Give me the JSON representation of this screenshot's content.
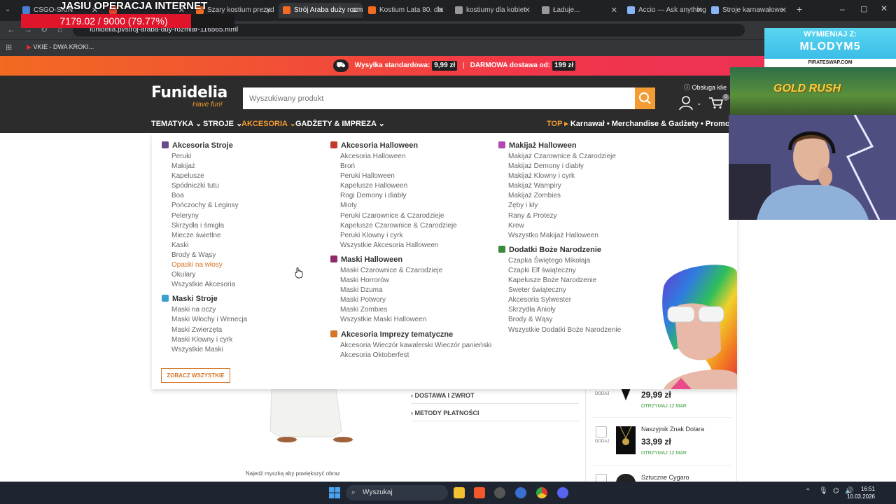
{
  "browser": {
    "tabs": [
      {
        "label": "CSGO-SKIN",
        "favicon_color": "#4a7fd6"
      },
      {
        "label": "",
        "favicon_color": "#e0452f"
      },
      {
        "label": "Szary kostium prezyd",
        "favicon_color": "#f36b21"
      },
      {
        "label": "Strój Araba duży rozm",
        "favicon_color": "#f36b21"
      },
      {
        "label": "Kostium Lata 80. dla",
        "favicon_color": "#f36b21"
      },
      {
        "label": "kostiumy dla kobiet",
        "favicon_color": "#999999"
      },
      {
        "label": "Ładuje...",
        "favicon_color": "#999999"
      },
      {
        "label": "Accio — Ask anything",
        "favicon_color": "#8ab4f8"
      },
      {
        "label": "Stroje karnawałowe",
        "favicon_color": "#8ab4f8"
      }
    ],
    "active_tab_index": 3,
    "url": "funidelia.pl/stroj-araba-duy-rozmiar-116565.html",
    "bookmark": "VKIE - DWA KROKI..."
  },
  "overlay": {
    "title": "JASIU OPERACJA INTERNET",
    "progress_text": "7179.02 / 9000 (79.77%)",
    "progress_fraction": 0.7977
  },
  "promo": {
    "standard_label": "Wysyłka standardowa:",
    "standard_price": "9,99 zł",
    "free_label": "DARMOWA dostawa od:",
    "free_price": "199 zł"
  },
  "header": {
    "logo": "Funidelia",
    "logo_tagline": "Have fun!",
    "search_placeholder": "Wyszukiwany produkt",
    "support_label": "Obsługa klie",
    "cart_count": "0",
    "nav": [
      "TEMATYKA",
      "STROJE",
      "AKCESORIA",
      "GADŻETY & IMPREZA"
    ],
    "top_label": "TOP ▸",
    "top_links": [
      "Karnawał",
      "• Merchandise & Gadżety",
      "• Promoc"
    ]
  },
  "mega_menu": {
    "col1": [
      {
        "title": "Akcesoria Stroje",
        "icon_color": "#6b4a8a",
        "links": [
          "Peruki",
          "Makijaż",
          "Kapelusze",
          "Spódniczki tutu",
          "Boa",
          "Pończochy & Leginsy",
          "Peleryny",
          "Skrzydła i śmigła",
          "Miecze świetlne",
          "Kaski",
          "Brody & Wąsy",
          "Opaski na włosy",
          "Okulary",
          "Wszystkie Akcesoria"
        ]
      },
      {
        "title": "Maski Stroje",
        "icon_color": "#3aa0d0",
        "links": [
          "Maski na oczy",
          "Maski Włochy i Wenecja",
          "Maski Zwierzęta",
          "Maski Klowny i cyrk",
          "Wszystkie Maski"
        ]
      }
    ],
    "col2": [
      {
        "title": "Akcesoria Halloween",
        "icon_color": "#c0392b",
        "links": [
          "Akcesoria Halloween",
          "Broń",
          "Peruki Halloween",
          "Kapelusze Halloween",
          "Rogi Demony i diabły",
          "Mioty",
          "Peruki Czarownice & Czarodzieje",
          "Kapelusze Czarownice & Czarodzieje",
          "Peruki Klowny i cyrk",
          "Wszystkie Akcesoria Halloween"
        ]
      },
      {
        "title": "Maski Halloween",
        "icon_color": "#8e2a6a",
        "links": [
          "Maski Czarownice & Czarodzieje",
          "Maski Horrorów",
          "Maski Dzuma",
          "Maski Potwory",
          "Maski Zombies",
          "Wszystkie Maski Halloween"
        ]
      },
      {
        "title": "Akcesoria Imprezy tematyczne",
        "icon_color": "#d4762a",
        "links": [
          "Akcesoria Wieczór kawalerski Wieczór panieński",
          "Akcesoria Oktoberfest"
        ]
      }
    ],
    "col3": [
      {
        "title": "Makijaż Halloween",
        "icon_color": "#b04ab0",
        "links": [
          "Makijaż Czarownice & Czarodzieje",
          "Makijaż Demony i diabły",
          "Makijaż Klowny i cyrk",
          "Makijaż Wampiry",
          "Makijaż Zombies",
          "Zęby i kły",
          "Rany & Protezy",
          "Krew",
          "Wszystko Makijaż Halloween"
        ]
      },
      {
        "title": "Dodatki Boże Narodzenie",
        "icon_color": "#3a8a3a",
        "links": [
          "Czapka Świętego Mikołaja",
          "Czapki Elf świąteczny",
          "Kapelusze Boże Narodzenie",
          "Sweter świąteczny",
          "Akcesoria Sylwester",
          "Skrzydła Anioły",
          "Brody & Wąsy",
          "Wszystkie Dodatki Boże Narodzenie"
        ]
      }
    ],
    "highlighted_link": "Opaski na włosy",
    "see_all": "ZOBACZ WSZYSTKIE"
  },
  "product": {
    "info_links": [
      "DOSTAWA I ZWROT",
      "METODY PŁATNOŚCI"
    ],
    "zoom_hint": "Najedź myszką aby powiększyć obraz"
  },
  "side_products": [
    {
      "add_label": "DODAJ",
      "name": "",
      "price": "29,99 zł",
      "delivery": "OTRZYMAJ 12 MAR"
    },
    {
      "add_label": "DODAJ",
      "name": "Naszyjnik Znak Dolara",
      "price": "33,99 zł",
      "delivery": "OTRZYMAJ 12 MAR"
    },
    {
      "add_label": "",
      "name": "Sztuczne Cygaro",
      "price": "",
      "delivery": ""
    }
  ],
  "stream_cam": {
    "banner_text": "WYMIENIAJ Z:",
    "banner_code": "MLODYM5",
    "banner_site": "PIRATESWAP.COM",
    "game_text": "GOLD RUSH"
  },
  "taskbar": {
    "search_label": "Wyszukaj",
    "time": "16:51",
    "date": "10.03.2026"
  }
}
